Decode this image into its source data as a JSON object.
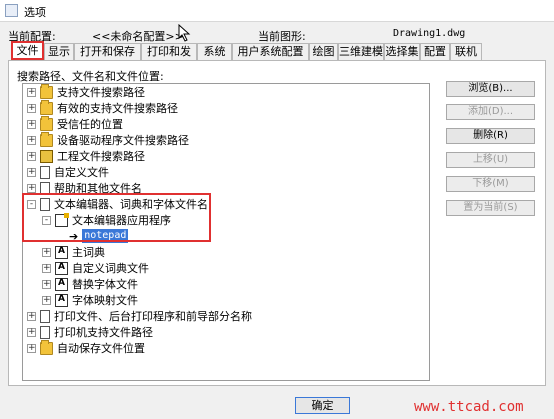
{
  "window": {
    "title": "选项"
  },
  "profile": {
    "current_label": "当前配置:",
    "current_value": "<<未命名配置>>",
    "drawing_label": "当前图形:",
    "drawing_value": "Drawing1.dwg"
  },
  "tabs": [
    "文件",
    "显示",
    "打开和保存",
    "打印和发布",
    "系统",
    "用户系统配置",
    "绘图",
    "三维建模",
    "选择集",
    "配置",
    "联机"
  ],
  "panel": {
    "search_label": "搜索路径、文件名和文件位置:"
  },
  "tree": [
    {
      "label": "支持文件搜索路径",
      "icon": "folder-icon",
      "expander": "+"
    },
    {
      "label": "有效的支持文件搜索路径",
      "icon": "folder-icon",
      "expander": "+"
    },
    {
      "label": "受信任的位置",
      "icon": "folder-icon",
      "expander": "+"
    },
    {
      "label": "设备驱动程序文件搜索路径",
      "icon": "folder-icon",
      "expander": "+"
    },
    {
      "label": "工程文件搜索路径",
      "icon": "book-icon",
      "expander": "+"
    },
    {
      "label": "自定义文件",
      "icon": "document-icon",
      "expander": "+"
    },
    {
      "label": "帮助和其他文件名",
      "icon": "document-icon",
      "expander": "+"
    },
    {
      "label": "文本编辑器、词典和字体文件名",
      "icon": "document-icon",
      "expander": "-"
    },
    {
      "label": "文本编辑器应用程序",
      "icon": "edit-icon",
      "expander": "-"
    },
    {
      "label": "notepad",
      "icon": "arrow-icon",
      "expander": ""
    },
    {
      "label": "主词典",
      "icon": "dictionary-icon",
      "expander": "+"
    },
    {
      "label": "自定义词典文件",
      "icon": "dictionary-icon",
      "expander": "+"
    },
    {
      "label": "替换字体文件",
      "icon": "font-icon",
      "expander": "+"
    },
    {
      "label": "字体映射文件",
      "icon": "font-icon",
      "expander": "+"
    },
    {
      "label": "打印文件、后台打印程序和前导部分名称",
      "icon": "document-icon",
      "expander": "+"
    },
    {
      "label": "打印机支持文件路径",
      "icon": "document-icon",
      "expander": "+"
    },
    {
      "label": "自动保存文件位置",
      "icon": "folder-icon",
      "expander": "+"
    }
  ],
  "buttons": {
    "browse": "浏览(B)...",
    "add": "添加(D)...",
    "remove": "删除(R)",
    "move_up": "上移(U)",
    "move_down": "下移(M)",
    "set_current": "置为当前(S)"
  },
  "footer": {
    "ok": "确定",
    "watermark": "www.ttcad.com"
  },
  "colors": {
    "highlight_box": "#e03030",
    "selection": "#3a78d8"
  }
}
